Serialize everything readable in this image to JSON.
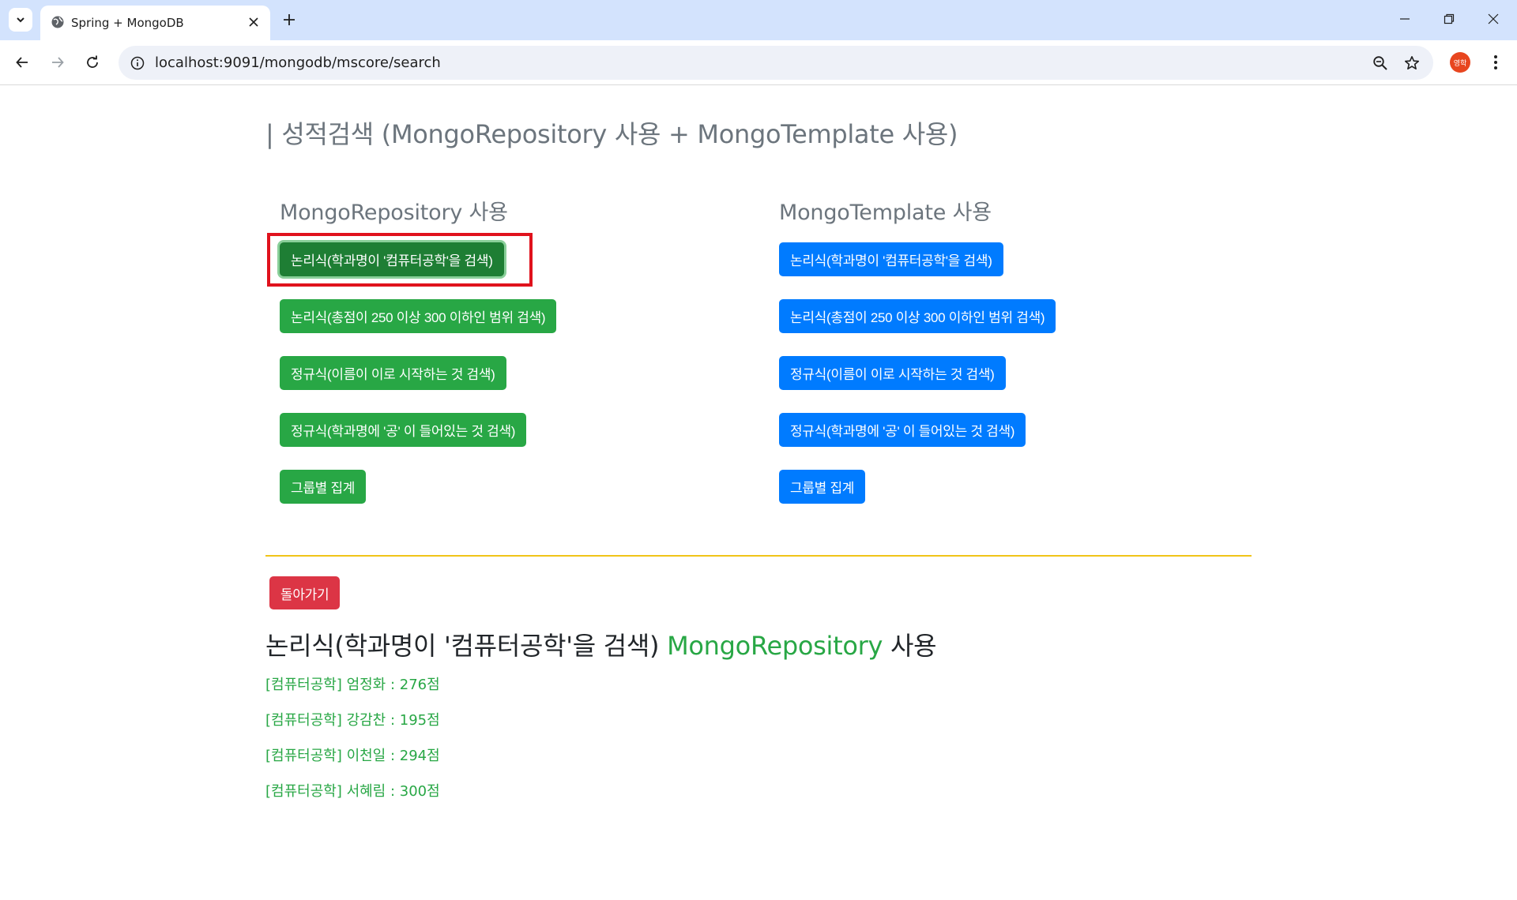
{
  "browser": {
    "tab_title": "Spring + MongoDB",
    "url": "localhost:9091/mongodb/mscore/search",
    "profile_label": "영학"
  },
  "page": {
    "title": "| 성적검색 (MongoRepository 사용 + MongoTemplate 사용)"
  },
  "repository": {
    "heading": "MongoRepository 사용",
    "buttons": [
      "논리식(학과명이 '컴퓨터공학'을 검색)",
      "논리식(총점이 250 이상 300 이하인 범위 검색)",
      "정규식(이름이 이로 시작하는 것 검색)",
      "정규식(학과명에 '공' 이 들어있는 것 검색)",
      "그룹별 집계"
    ]
  },
  "template": {
    "heading": "MongoTemplate 사용",
    "buttons": [
      "논리식(학과명이 '컴퓨터공학'을 검색)",
      "논리식(총점이 250 이상 300 이하인 범위 검색)",
      "정규식(이름이 이로 시작하는 것 검색)",
      "정규식(학과명에 '공' 이 들어있는 것 검색)",
      "그룹별 집계"
    ]
  },
  "back_button": "돌아가기",
  "result": {
    "title": "논리식(학과명이 '컴퓨터공학'을 검색)",
    "accent": "MongoRepository",
    "suffix": "사용",
    "items": [
      "[컴퓨터공학] 엄정화 : 276점",
      "[컴퓨터공학] 강감찬 : 195점",
      "[컴퓨터공학] 이천일 : 294점",
      "[컴퓨터공학] 서혜림 : 300점"
    ]
  },
  "colors": {
    "green": "#28a745",
    "blue": "#007bff",
    "red": "#dc3545",
    "highlight": "#e0121d",
    "divider": "#f0c419"
  }
}
